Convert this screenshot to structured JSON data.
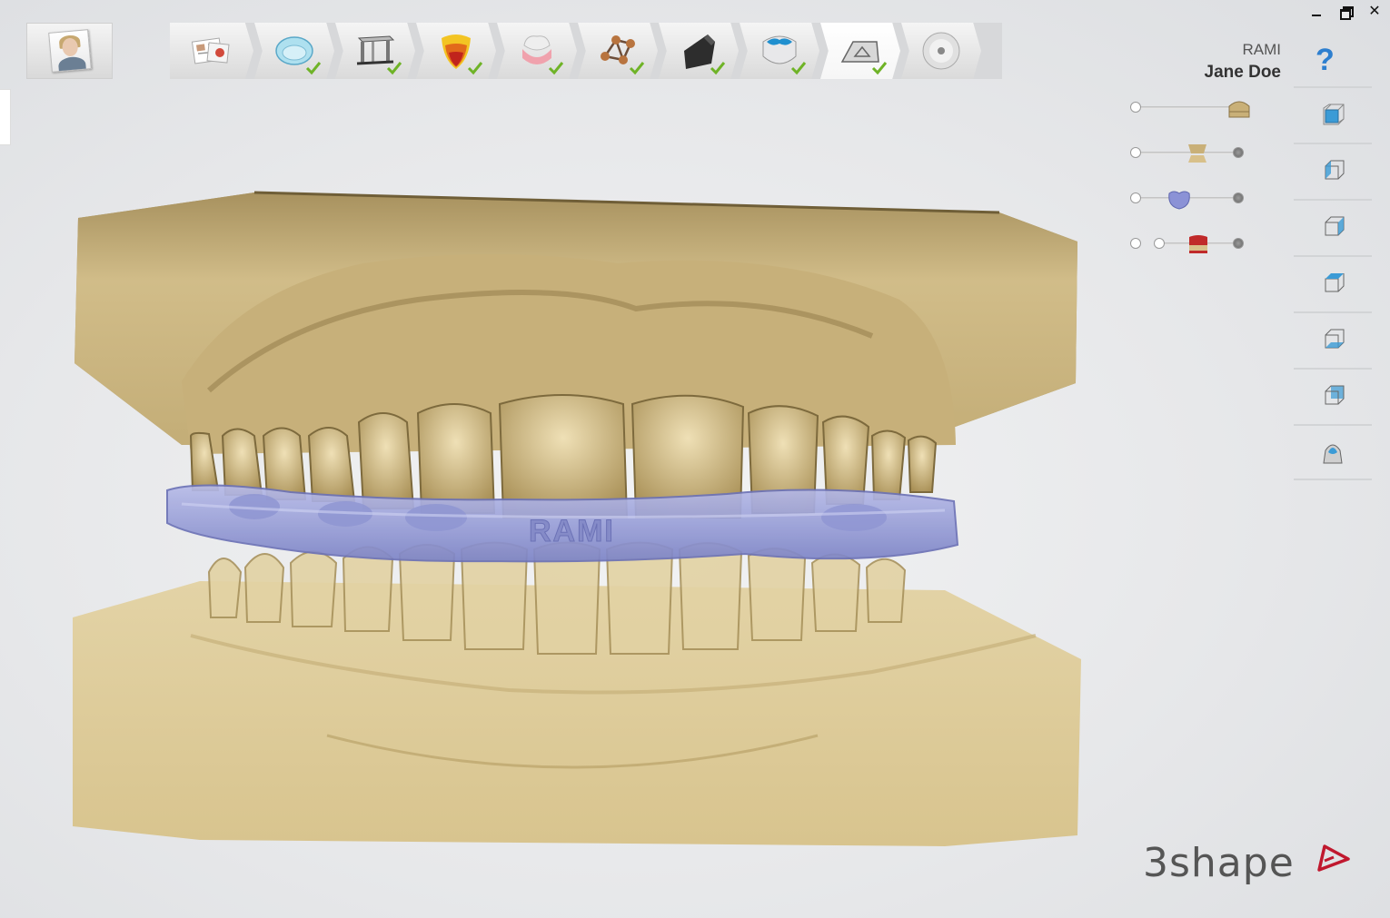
{
  "window": {
    "minimize_icon": "minimize-icon",
    "restore_icon": "restore-icon",
    "close_glyph": "✕"
  },
  "patient": {
    "icon": "patient-photo-icon"
  },
  "workflow": {
    "steps": [
      {
        "name": "order-form",
        "icon": "order-form-icon",
        "done": false,
        "active": false
      },
      {
        "name": "scan",
        "icon": "dental-arch-icon",
        "done": true,
        "active": false
      },
      {
        "name": "model-base",
        "icon": "model-base-icon",
        "done": true,
        "active": false
      },
      {
        "name": "die",
        "icon": "die-icon",
        "done": true,
        "active": false
      },
      {
        "name": "gingiva",
        "icon": "gingiva-icon",
        "done": true,
        "active": false
      },
      {
        "name": "articulator",
        "icon": "articulator-icon",
        "done": true,
        "active": false
      },
      {
        "name": "sculpt",
        "icon": "sculpt-tool-icon",
        "done": true,
        "active": false
      },
      {
        "name": "crown",
        "icon": "crown-icon",
        "done": true,
        "active": false
      },
      {
        "name": "plate",
        "icon": "plate-icon",
        "done": true,
        "active": true
      },
      {
        "name": "save",
        "icon": "disc-icon",
        "done": false,
        "active": false
      }
    ]
  },
  "user": {
    "org": "RAMI",
    "name": "Jane Doe"
  },
  "help": {
    "label": "?"
  },
  "sliders": [
    {
      "name": "upper-model-opacity",
      "color": "#c9b078",
      "value": 1.0
    },
    {
      "name": "lower-model-opacity",
      "color": "#c9b078",
      "value": 0.55
    },
    {
      "name": "splint-opacity",
      "color": "#8b92d6",
      "value": 0.4
    },
    {
      "name": "collision-opacity",
      "color": "#c02a2a",
      "value": 0.45
    }
  ],
  "views": [
    {
      "name": "front-view",
      "icon": "cube-front-icon"
    },
    {
      "name": "left-view",
      "icon": "cube-left-icon"
    },
    {
      "name": "right-view",
      "icon": "cube-right-icon"
    },
    {
      "name": "top-view",
      "icon": "cube-top-icon"
    },
    {
      "name": "bottom-view",
      "icon": "cube-bottom-icon"
    },
    {
      "name": "back-view",
      "icon": "cube-back-icon"
    },
    {
      "name": "occlusal-view",
      "icon": "tooth-view-icon"
    }
  ],
  "model": {
    "splint_text": "RAMI",
    "stone_color": "#d8c28f",
    "splint_color": "#9aa0d8"
  },
  "brand": {
    "logo_text": "3shape",
    "accent": "#c0182e"
  }
}
